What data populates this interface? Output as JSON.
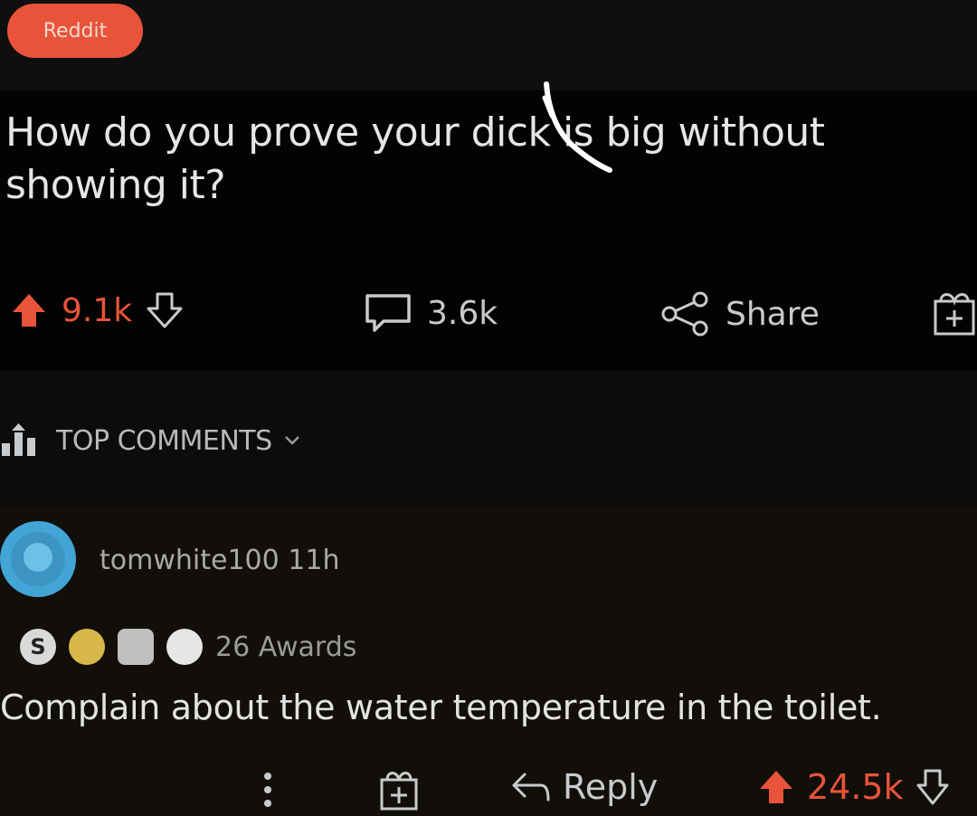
{
  "header": {
    "source_badge": "Reddit"
  },
  "post": {
    "title": "How do you prove your dick is big without showing it?",
    "upvotes": "9.1k",
    "comments": "3.6k",
    "share_label": "Share"
  },
  "sort": {
    "label": "TOP COMMENTS"
  },
  "comment": {
    "username": "tomwhite100",
    "age": "11h",
    "awards_label": "26 Awards",
    "body": "Complain about the water temperature in the toilet.",
    "reply_label": "Reply",
    "score": "24.5k"
  },
  "colors": {
    "accent": "#e8533a",
    "avatar": "#42a5d6",
    "background": "#030303"
  }
}
